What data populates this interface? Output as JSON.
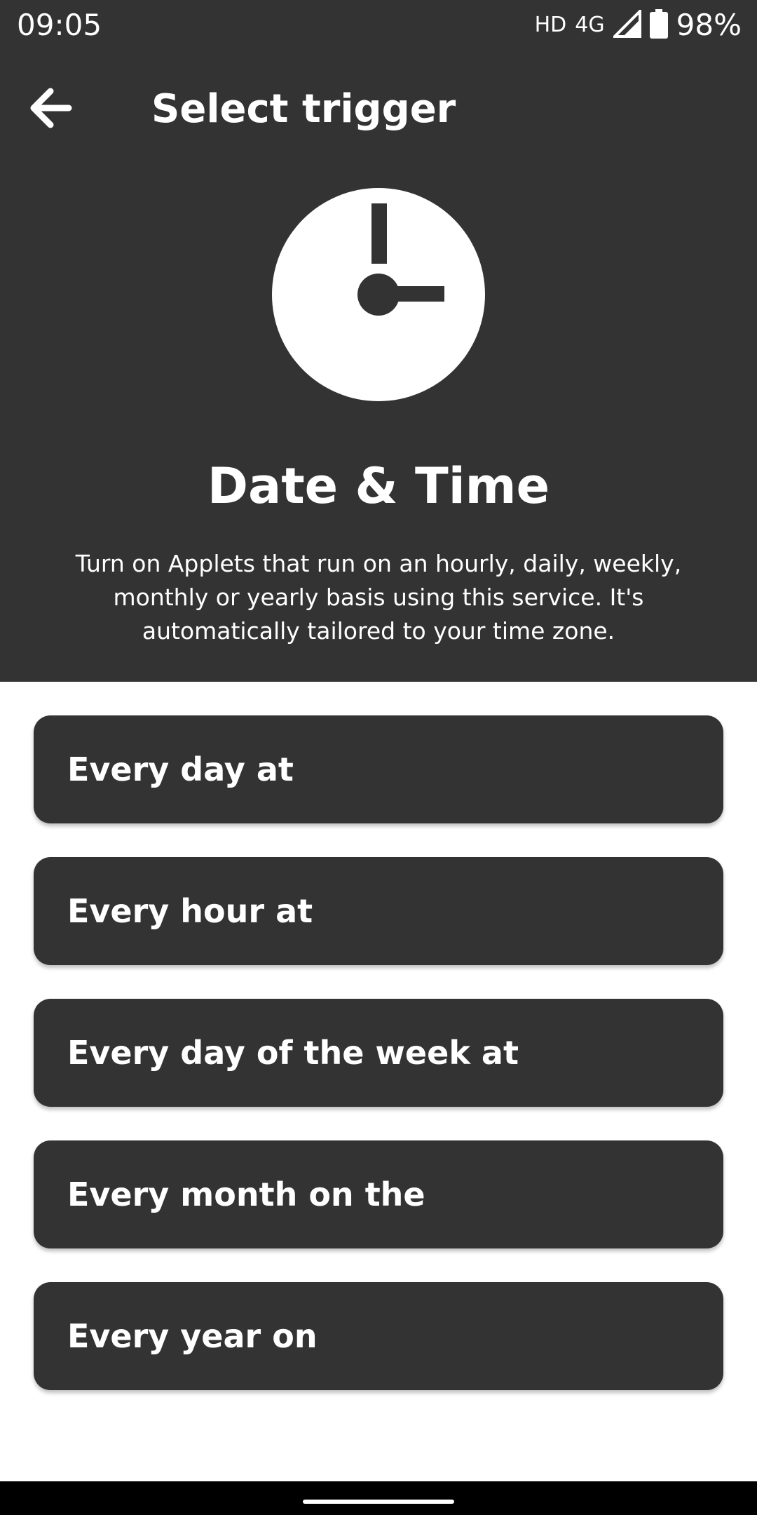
{
  "status_bar": {
    "time": "09:05",
    "hd": "HD",
    "network": "4G",
    "battery": "98%"
  },
  "toolbar": {
    "title": "Select trigger"
  },
  "service": {
    "icon": "clock-icon",
    "name": "Date & Time",
    "description": "Turn on Applets that run on an hourly, daily, weekly, monthly or yearly basis using this service. It's automatically tailored to your time zone."
  },
  "triggers": [
    {
      "label": "Every day at"
    },
    {
      "label": "Every hour at"
    },
    {
      "label": "Every day of the week at"
    },
    {
      "label": "Every month on the"
    },
    {
      "label": "Every year on"
    }
  ],
  "colors": {
    "header_bg": "#333333",
    "card_bg": "#333333",
    "text": "#ffffff",
    "page_bg": "#ffffff"
  }
}
